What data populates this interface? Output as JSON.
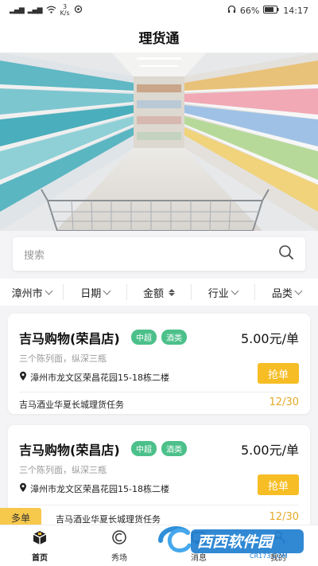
{
  "status_bar": {
    "left_net": "3",
    "left_net_unit": "K/s",
    "battery": "66%",
    "time": "14:17"
  },
  "title": "理货通",
  "search": {
    "placeholder": "搜索"
  },
  "filters": [
    {
      "label": "漳州市",
      "icon": "chevron-down-icon"
    },
    {
      "label": "日期",
      "icon": "chevron-down-icon"
    },
    {
      "label": "金额",
      "icon": "sort-icon"
    },
    {
      "label": "行业",
      "icon": "chevron-down-icon"
    },
    {
      "label": "品类",
      "icon": "chevron-down-icon"
    }
  ],
  "cards": [
    {
      "title": "吉马购物(荣昌店)",
      "tags": [
        "中超",
        "酒类"
      ],
      "price": "5.00元/单",
      "desc": "三个陈列面，纵深三瓶",
      "address": "漳州市龙文区荣昌花园15-18栋二楼",
      "button": "抢单",
      "task": "吉马酒业华夏长城理货任务",
      "progress": "12/30",
      "badge": ""
    },
    {
      "title": "吉马购物(荣昌店)",
      "tags": [
        "中超",
        "酒类"
      ],
      "price": "5.00元/单",
      "desc": "三个陈列面，纵深三瓶",
      "address": "漳州市龙文区荣昌花园15-18栋二楼",
      "button": "抢单",
      "task": "吉马酒业华夏长城理货任务",
      "progress": "12/30",
      "badge": "多单"
    }
  ],
  "bottom_nav": [
    {
      "label": "首页",
      "icon": "home-box-icon",
      "active": true
    },
    {
      "label": "秀场",
      "icon": "show-icon",
      "active": false
    },
    {
      "label": "消息",
      "icon": "message-icon",
      "active": false
    },
    {
      "label": "我的",
      "icon": "profile-icon",
      "active": false
    }
  ],
  "watermark": {
    "brand": "西西软件园",
    "url": "CR173.COM"
  },
  "colors": {
    "accent": "#f6bd25",
    "tag": "#4cc08a",
    "progress": "#e5a92a"
  }
}
